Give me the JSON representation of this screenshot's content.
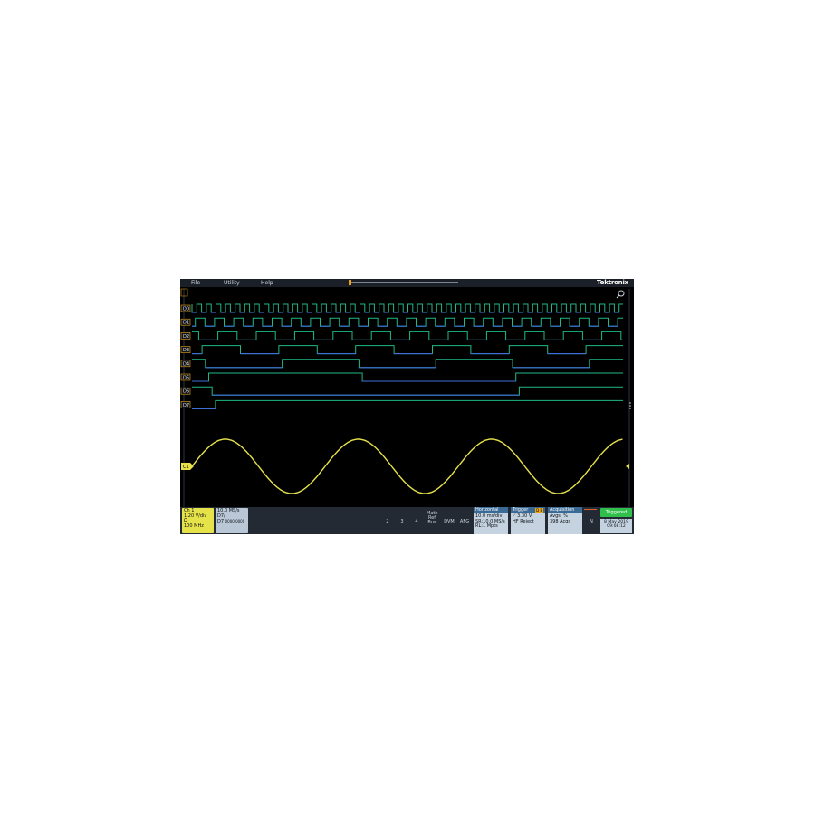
{
  "menubar": {
    "items": [
      "File",
      "Utility",
      "Help"
    ],
    "brand": "Tektronix"
  },
  "channels": {
    "labels": [
      "D0",
      "D1",
      "D2",
      "D3",
      "D4",
      "D5",
      "D6",
      "D7"
    ],
    "analog_label": "C1",
    "colors": {
      "d_high": "#1fb888",
      "d_low": "#3f6fd9",
      "analog": "#e6e24a",
      "label_border": "#e8a317"
    }
  },
  "ch1_badge": {
    "title": "Ch 1",
    "vdiv": "1.20 V/div",
    "coupling": "Ω",
    "bw": "100 MHz"
  },
  "dbadge": {
    "rate": "10.0 MS/s",
    "name": "D7/",
    "sub": "D7 ",
    "pattern": "0000 0000"
  },
  "buttons": [
    "2",
    "3",
    "4",
    "Math",
    "Ref",
    "Bus",
    "DVM",
    "AFG"
  ],
  "horizontal": {
    "title": "Horizontal",
    "line1": "10.0 ms/div",
    "line2": "SR:10.0 MS/s",
    "line3": "RL:1 Mpts"
  },
  "trigger": {
    "title": "Trigger",
    "tag": "D 8",
    "level": "3.30 V",
    "mode": "HF Reject"
  },
  "acquisition": {
    "title": "Acquisition",
    "line1": "Avgs: %",
    "line2": "398 Acqs"
  },
  "status": {
    "triggered": "Triggered",
    "date": "8 May 2019",
    "time": "09:08:12",
    "n_label": "N"
  },
  "colors": {
    "accent_green": "#2fbf4a",
    "panel_header": "#3a6b97",
    "ch1_yellow": "#e6e24a"
  }
}
